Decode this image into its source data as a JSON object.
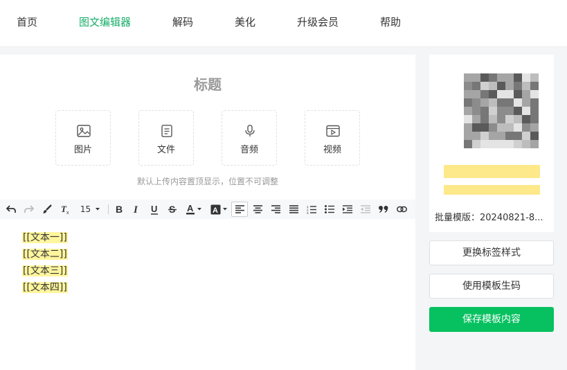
{
  "nav": {
    "items": [
      {
        "label": "首页",
        "active": false
      },
      {
        "label": "图文编辑器",
        "active": true
      },
      {
        "label": "解码",
        "active": false
      },
      {
        "label": "美化",
        "active": false
      },
      {
        "label": "升级会员",
        "active": false
      },
      {
        "label": "帮助",
        "active": false
      }
    ]
  },
  "editor": {
    "title": "标题",
    "uploads": [
      {
        "label": "图片",
        "icon": "image-icon"
      },
      {
        "label": "文件",
        "icon": "file-icon"
      },
      {
        "label": "音频",
        "icon": "microphone-icon"
      },
      {
        "label": "视频",
        "icon": "video-icon"
      }
    ],
    "hint": "默认上传内容置顶显示，位置不可调整",
    "toolbar": {
      "font_size": "15"
    },
    "lines": [
      "[[文本一]]",
      "[[文本二]]",
      "[[文本三]]",
      "[[文本四]]"
    ]
  },
  "sidebar": {
    "batch_label": "批量模版：20240821-8...",
    "buttons": {
      "change_style": "更换标签样式",
      "use_template": "使用模板生码",
      "save": "保存模板内容"
    }
  },
  "colors": {
    "accent": "#07c160",
    "nav_active": "#1aad6b",
    "highlight": "#fff59d"
  }
}
